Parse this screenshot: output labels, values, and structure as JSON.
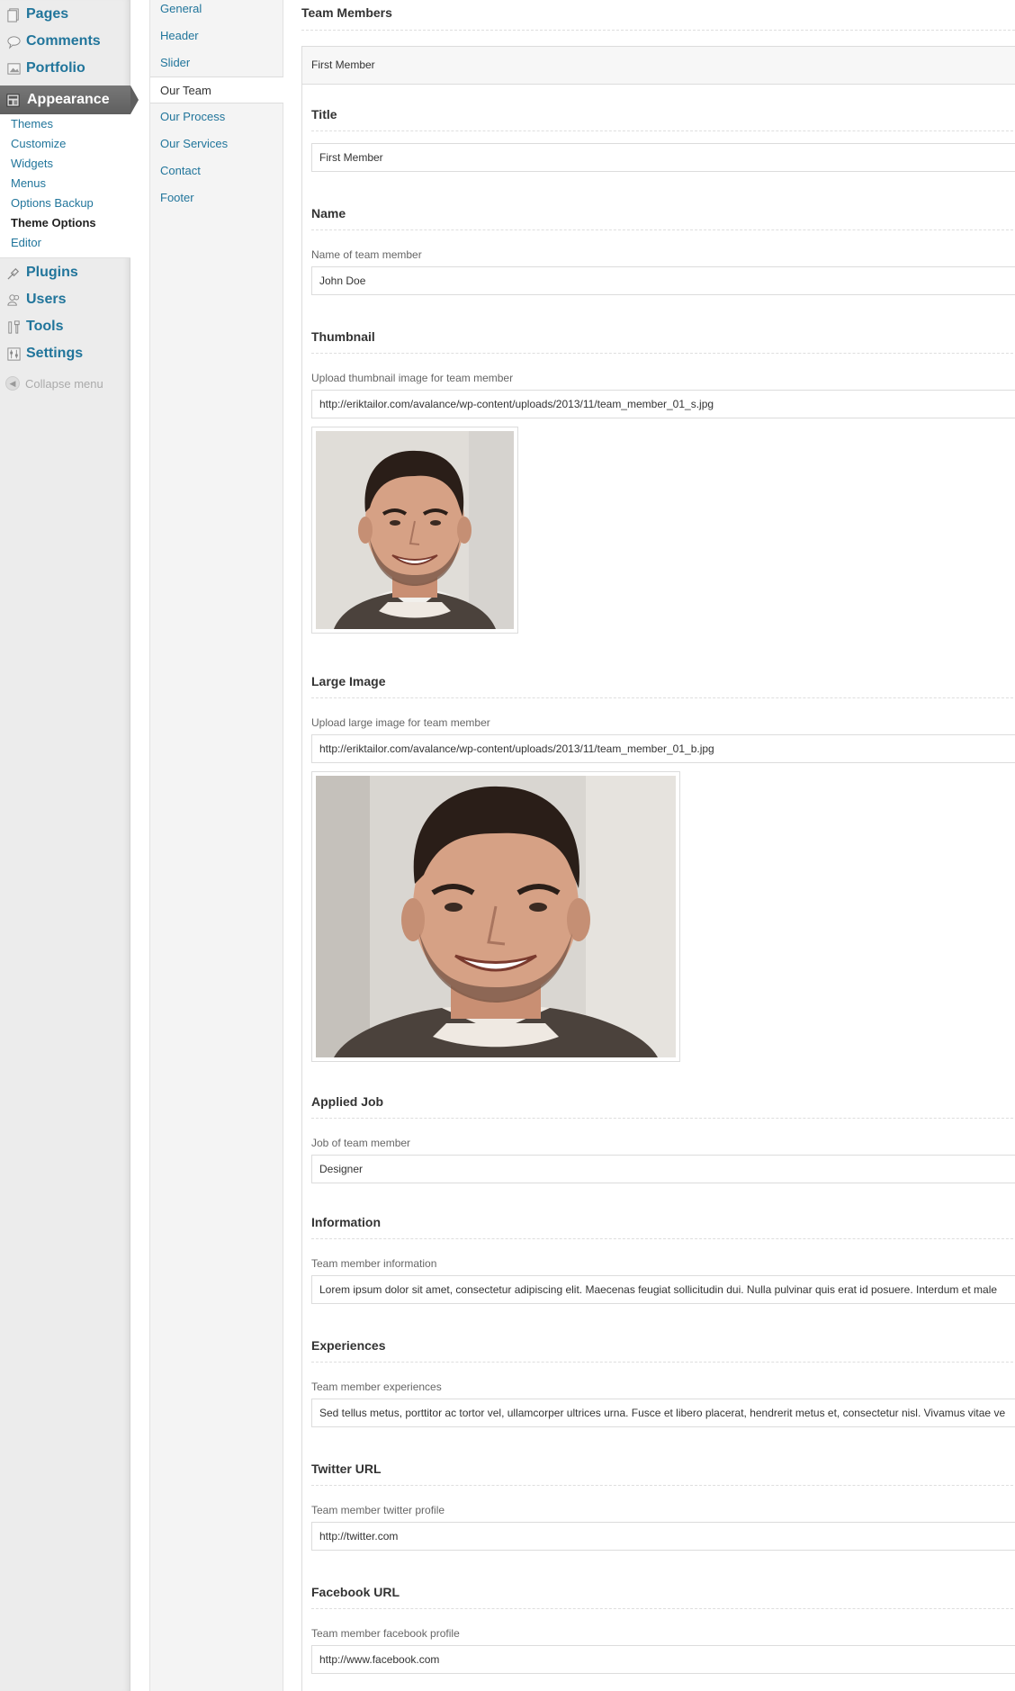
{
  "admin_menu": {
    "top_items": [
      {
        "label": "Pages",
        "icon": "pages-icon"
      },
      {
        "label": "Comments",
        "icon": "comments-icon"
      },
      {
        "label": "Portfolio",
        "icon": "portfolio-icon"
      }
    ],
    "current": {
      "label": "Appearance",
      "icon": "appearance-icon"
    },
    "submenu": [
      "Themes",
      "Customize",
      "Widgets",
      "Menus",
      "Options Backup",
      "Theme Options",
      "Editor"
    ],
    "submenu_current": "Theme Options",
    "bottom_items": [
      {
        "label": "Plugins",
        "icon": "plugins-icon"
      },
      {
        "label": "Users",
        "icon": "users-icon"
      },
      {
        "label": "Tools",
        "icon": "tools-icon"
      },
      {
        "label": "Settings",
        "icon": "settings-icon"
      }
    ],
    "collapse_label": "Collapse menu"
  },
  "option_tabs": [
    "General",
    "Header",
    "Slider",
    "Our Team",
    "Our Process",
    "Our Services",
    "Contact",
    "Footer"
  ],
  "active_tab": "Our Team",
  "section": {
    "title": "Team Members",
    "panel_title": "First Member"
  },
  "fields": {
    "title": {
      "label": "Title",
      "value": "First Member"
    },
    "name": {
      "label": "Name",
      "desc": "Name of team member",
      "value": "John Doe"
    },
    "thumbnail": {
      "label": "Thumbnail",
      "desc": "Upload thumbnail image for team member",
      "value": "http://eriktailor.com/avalance/wp-content/uploads/2013/11/team_member_01_s.jpg"
    },
    "large_image": {
      "label": "Large Image",
      "desc": "Upload large image for team member",
      "value": "http://eriktailor.com/avalance/wp-content/uploads/2013/11/team_member_01_b.jpg"
    },
    "job": {
      "label": "Applied Job",
      "desc": "Job of team member",
      "value": "Designer"
    },
    "information": {
      "label": "Information",
      "desc": "Team member information",
      "value": "Lorem ipsum dolor sit amet, consectetur adipiscing elit. Maecenas feugiat sollicitudin dui. Nulla pulvinar quis erat id posuere. Interdum et male"
    },
    "experiences": {
      "label": "Experiences",
      "desc": "Team member experiences",
      "value": "Sed tellus metus, porttitor ac tortor vel, ullamcorper ultrices urna. Fusce et libero placerat, hendrerit metus et, consectetur nisl. Vivamus vitae ve"
    },
    "twitter": {
      "label": "Twitter URL",
      "desc": "Team member twitter profile",
      "value": "http://twitter.com"
    },
    "facebook": {
      "label": "Facebook URL",
      "desc": "Team member facebook profile",
      "value": "http://www.facebook.com"
    }
  },
  "colors": {
    "link": "#21759b",
    "current_menu": "#666666",
    "border": "#dcdcdc"
  }
}
